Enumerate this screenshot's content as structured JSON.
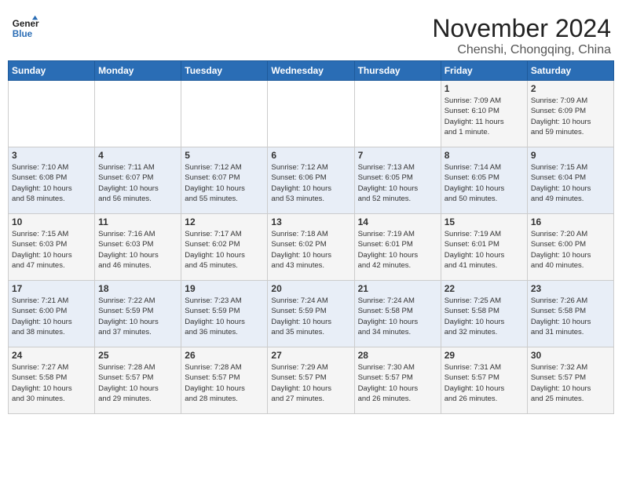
{
  "header": {
    "logo_line1": "General",
    "logo_line2": "Blue",
    "month": "November 2024",
    "location": "Chenshi, Chongqing, China"
  },
  "weekdays": [
    "Sunday",
    "Monday",
    "Tuesday",
    "Wednesday",
    "Thursday",
    "Friday",
    "Saturday"
  ],
  "weeks": [
    [
      {
        "day": "",
        "detail": ""
      },
      {
        "day": "",
        "detail": ""
      },
      {
        "day": "",
        "detail": ""
      },
      {
        "day": "",
        "detail": ""
      },
      {
        "day": "",
        "detail": ""
      },
      {
        "day": "1",
        "detail": "Sunrise: 7:09 AM\nSunset: 6:10 PM\nDaylight: 11 hours\nand 1 minute."
      },
      {
        "day": "2",
        "detail": "Sunrise: 7:09 AM\nSunset: 6:09 PM\nDaylight: 10 hours\nand 59 minutes."
      }
    ],
    [
      {
        "day": "3",
        "detail": "Sunrise: 7:10 AM\nSunset: 6:08 PM\nDaylight: 10 hours\nand 58 minutes."
      },
      {
        "day": "4",
        "detail": "Sunrise: 7:11 AM\nSunset: 6:07 PM\nDaylight: 10 hours\nand 56 minutes."
      },
      {
        "day": "5",
        "detail": "Sunrise: 7:12 AM\nSunset: 6:07 PM\nDaylight: 10 hours\nand 55 minutes."
      },
      {
        "day": "6",
        "detail": "Sunrise: 7:12 AM\nSunset: 6:06 PM\nDaylight: 10 hours\nand 53 minutes."
      },
      {
        "day": "7",
        "detail": "Sunrise: 7:13 AM\nSunset: 6:05 PM\nDaylight: 10 hours\nand 52 minutes."
      },
      {
        "day": "8",
        "detail": "Sunrise: 7:14 AM\nSunset: 6:05 PM\nDaylight: 10 hours\nand 50 minutes."
      },
      {
        "day": "9",
        "detail": "Sunrise: 7:15 AM\nSunset: 6:04 PM\nDaylight: 10 hours\nand 49 minutes."
      }
    ],
    [
      {
        "day": "10",
        "detail": "Sunrise: 7:15 AM\nSunset: 6:03 PM\nDaylight: 10 hours\nand 47 minutes."
      },
      {
        "day": "11",
        "detail": "Sunrise: 7:16 AM\nSunset: 6:03 PM\nDaylight: 10 hours\nand 46 minutes."
      },
      {
        "day": "12",
        "detail": "Sunrise: 7:17 AM\nSunset: 6:02 PM\nDaylight: 10 hours\nand 45 minutes."
      },
      {
        "day": "13",
        "detail": "Sunrise: 7:18 AM\nSunset: 6:02 PM\nDaylight: 10 hours\nand 43 minutes."
      },
      {
        "day": "14",
        "detail": "Sunrise: 7:19 AM\nSunset: 6:01 PM\nDaylight: 10 hours\nand 42 minutes."
      },
      {
        "day": "15",
        "detail": "Sunrise: 7:19 AM\nSunset: 6:01 PM\nDaylight: 10 hours\nand 41 minutes."
      },
      {
        "day": "16",
        "detail": "Sunrise: 7:20 AM\nSunset: 6:00 PM\nDaylight: 10 hours\nand 40 minutes."
      }
    ],
    [
      {
        "day": "17",
        "detail": "Sunrise: 7:21 AM\nSunset: 6:00 PM\nDaylight: 10 hours\nand 38 minutes."
      },
      {
        "day": "18",
        "detail": "Sunrise: 7:22 AM\nSunset: 5:59 PM\nDaylight: 10 hours\nand 37 minutes."
      },
      {
        "day": "19",
        "detail": "Sunrise: 7:23 AM\nSunset: 5:59 PM\nDaylight: 10 hours\nand 36 minutes."
      },
      {
        "day": "20",
        "detail": "Sunrise: 7:24 AM\nSunset: 5:59 PM\nDaylight: 10 hours\nand 35 minutes."
      },
      {
        "day": "21",
        "detail": "Sunrise: 7:24 AM\nSunset: 5:58 PM\nDaylight: 10 hours\nand 34 minutes."
      },
      {
        "day": "22",
        "detail": "Sunrise: 7:25 AM\nSunset: 5:58 PM\nDaylight: 10 hours\nand 32 minutes."
      },
      {
        "day": "23",
        "detail": "Sunrise: 7:26 AM\nSunset: 5:58 PM\nDaylight: 10 hours\nand 31 minutes."
      }
    ],
    [
      {
        "day": "24",
        "detail": "Sunrise: 7:27 AM\nSunset: 5:58 PM\nDaylight: 10 hours\nand 30 minutes."
      },
      {
        "day": "25",
        "detail": "Sunrise: 7:28 AM\nSunset: 5:57 PM\nDaylight: 10 hours\nand 29 minutes."
      },
      {
        "day": "26",
        "detail": "Sunrise: 7:28 AM\nSunset: 5:57 PM\nDaylight: 10 hours\nand 28 minutes."
      },
      {
        "day": "27",
        "detail": "Sunrise: 7:29 AM\nSunset: 5:57 PM\nDaylight: 10 hours\nand 27 minutes."
      },
      {
        "day": "28",
        "detail": "Sunrise: 7:30 AM\nSunset: 5:57 PM\nDaylight: 10 hours\nand 26 minutes."
      },
      {
        "day": "29",
        "detail": "Sunrise: 7:31 AM\nSunset: 5:57 PM\nDaylight: 10 hours\nand 26 minutes."
      },
      {
        "day": "30",
        "detail": "Sunrise: 7:32 AM\nSunset: 5:57 PM\nDaylight: 10 hours\nand 25 minutes."
      }
    ]
  ]
}
